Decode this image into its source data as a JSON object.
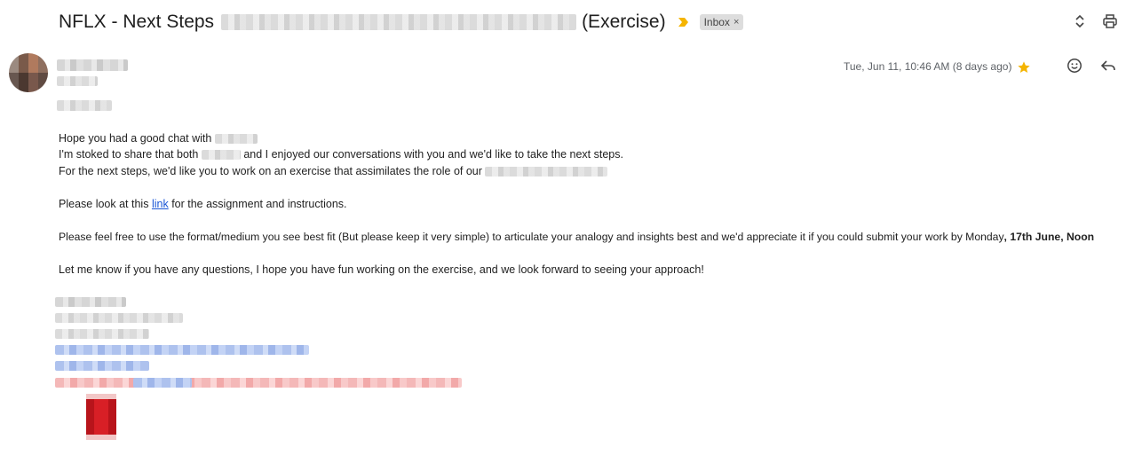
{
  "email": {
    "subject_prefix": "NFLX - Next Steps",
    "subject_suffix": "(Exercise)",
    "label": "Inbox",
    "label_close": "×",
    "timestamp": "Tue, Jun 11, 10:46 AM (8 days ago)",
    "starred": true,
    "body": {
      "line1_prefix": "Hope you had a good chat with",
      "line2_prefix": "I'm stoked to share that both",
      "line2_suffix": "and I enjoyed our conversations with you and we'd like to take the next steps.",
      "line3_prefix": "For the next steps, we'd like you to work on an exercise that assimilates the role of our",
      "line4_prefix": "Please look at this",
      "line4_link": "link",
      "line4_suffix": "for the assignment and instructions.",
      "line5_prefix": "Please feel free to use the format/medium you see best fit (But please keep it very simple) to articulate your analogy and insights best and we'd appreciate it if you could submit your work by Monday",
      "line5_bold": ", 17th June, Noon",
      "line6": "Let me know if you have any questions, I hope you have fun working on the exercise, and we look forward to seeing your approach!"
    }
  },
  "icons": {
    "important": "important-marker-icon",
    "expand": "expand-collapse-icon",
    "print": "print-icon",
    "star": "star-icon",
    "emoji": "emoji-react-icon",
    "reply": "reply-icon"
  },
  "colors": {
    "important": "#f5b400",
    "star": "#f4b400",
    "link": "#1a56d6",
    "chip_bg": "#dddddd"
  }
}
